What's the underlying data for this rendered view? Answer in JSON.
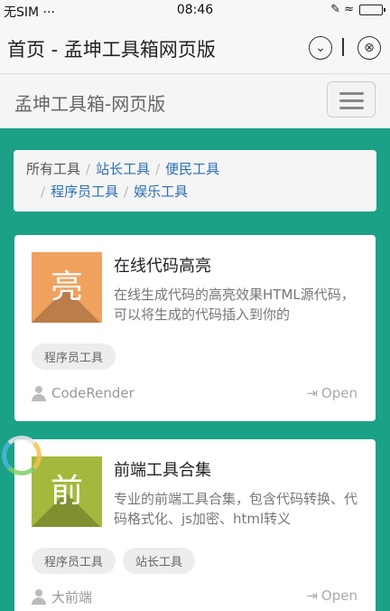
{
  "status_bar": {
    "carrier": "无SIM ···",
    "time": "08:46",
    "right_icons": "✎ ≈"
  },
  "title_bar": {
    "title": "首页 - 孟坤工具箱网页版",
    "dropdown_icon": "⌄",
    "close_icon": "⊗"
  },
  "navbar": {
    "brand": "孟坤工具箱-网页版"
  },
  "breadcrumb": {
    "items": [
      "所有工具",
      "站长工具",
      "便民工具",
      "程序员工具",
      "娱乐工具"
    ],
    "separator": "/"
  },
  "cards": [
    {
      "thumb_char": "亮",
      "thumb_color": "#f0a15e",
      "title": "在线代码高亮",
      "description": "在线生成代码的高亮效果HTML源代码，可以将生成的代码插入到你的",
      "tags": [
        "程序员工具"
      ],
      "author": "CodeRender",
      "open_label": "Open"
    },
    {
      "thumb_char": "前",
      "thumb_color": "#a4b83e",
      "title": "前端工具合集",
      "description": "专业的前端工具合集，包含代码转换、代码格式化、js加密、html转义",
      "tags": [
        "程序员工具",
        "站长工具"
      ],
      "author": "大前端",
      "open_label": "Open"
    }
  ]
}
